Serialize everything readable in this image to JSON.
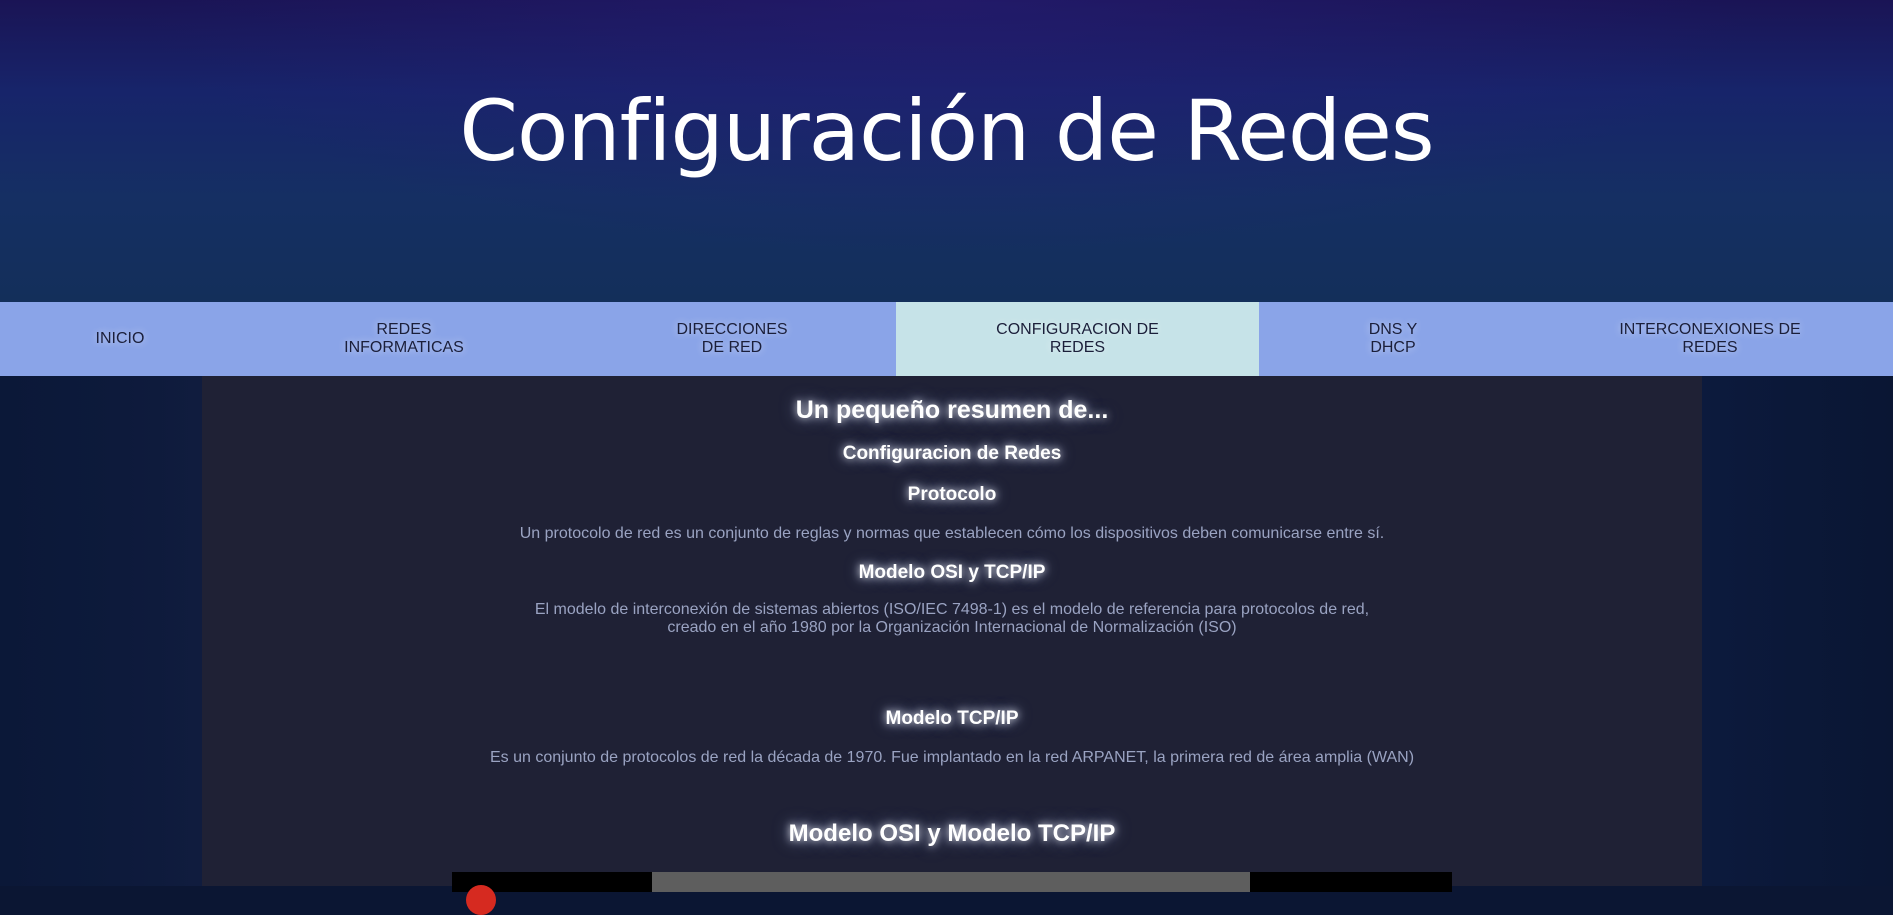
{
  "header": {
    "title": "Configuración de Redes"
  },
  "nav": {
    "items": [
      {
        "label": "INICIO"
      },
      {
        "label": "REDES\nINFORMATICAS"
      },
      {
        "label": "DIRECCIONES\nDE RED"
      },
      {
        "label": "CONFIGURACION DE\nREDES",
        "active": true
      },
      {
        "label": "DNS Y\nDHCP"
      },
      {
        "label": "INTERCONEXIONES DE\nREDES"
      }
    ]
  },
  "main": {
    "heading": "Un pequeño resumen de...",
    "subheading": "Configuracion de Redes",
    "sections": [
      {
        "title": "Protocolo",
        "text": "Un protocolo de red es un conjunto de reglas y normas que establecen cómo los dispositivos deben comunicarse entre sí."
      },
      {
        "title": "Modelo OSI y TCP/IP",
        "text": "El modelo de interconexión de sistemas abiertos (ISO/IEC 7498-1) es el modelo de referencia para protocolos de red,\ncreado en el año 1980 por la Organización Internacional de Normalización (ISO)"
      },
      {
        "title": "Modelo TCP/IP",
        "text": "Es un conjunto de protocolos de red la década de 1970. Fue implantado en la red ARPANET, la primera red de área amplia (WAN)"
      }
    ],
    "video_heading": "Modelo OSI y Modelo TCP/IP"
  },
  "colors": {
    "nav_background": "#8aa4e8",
    "nav_active": "#c6e3e8",
    "content_background": "#1f2135",
    "paragraph_text": "#9aa3c2"
  }
}
